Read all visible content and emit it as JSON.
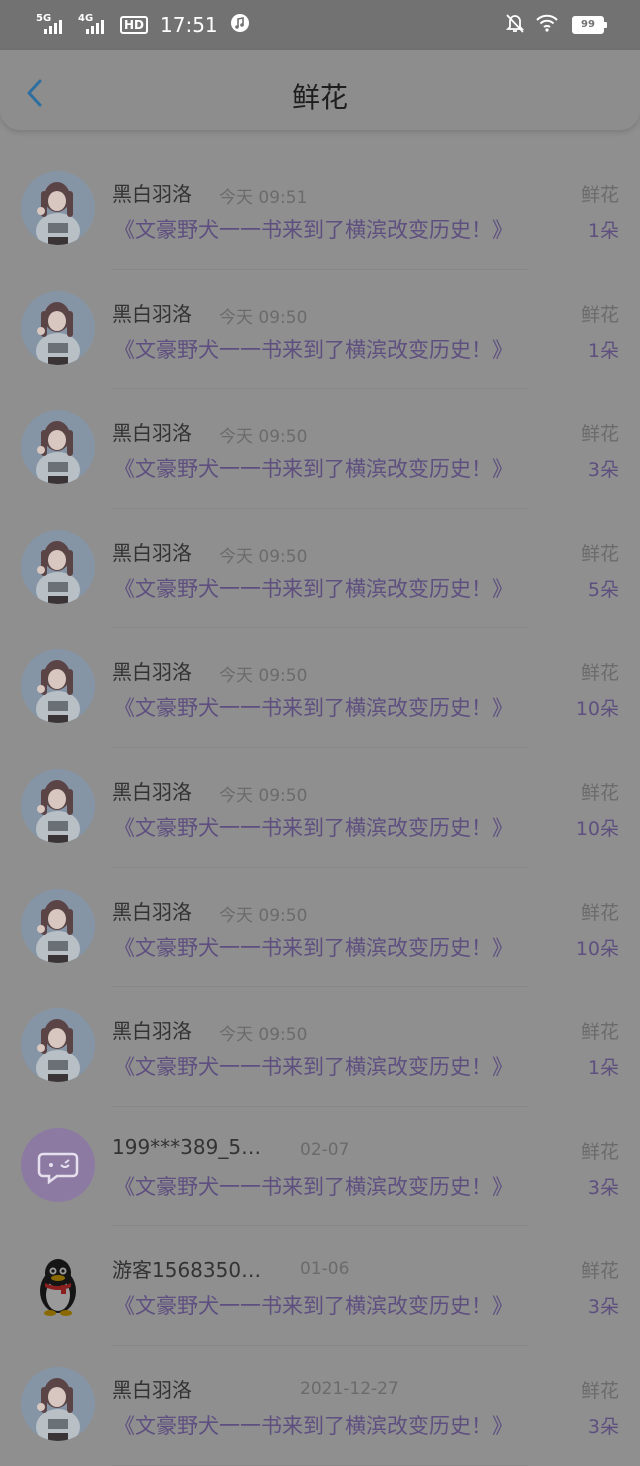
{
  "status_bar": {
    "network_1": "5G",
    "network_2": "4G",
    "hd_badge": "HD",
    "time": "17:51",
    "battery": "99"
  },
  "header": {
    "title": "鲜花",
    "back_icon": "chevron-left-icon"
  },
  "colors": {
    "accent_blue": "#2f6f9f",
    "book_purple": "#5e4f80",
    "avatar_purple": "#8c7aa3"
  },
  "records": [
    {
      "user": "黑白羽洛",
      "time": "今天 09:51",
      "book": "《文豪野犬一一书来到了横滨改变历史！》",
      "gift": "鲜花",
      "count": "1朵",
      "avatar": "anime-girl"
    },
    {
      "user": "黑白羽洛",
      "time": "今天 09:50",
      "book": "《文豪野犬一一书来到了横滨改变历史！》",
      "gift": "鲜花",
      "count": "1朵",
      "avatar": "anime-girl"
    },
    {
      "user": "黑白羽洛",
      "time": "今天 09:50",
      "book": "《文豪野犬一一书来到了横滨改变历史！》",
      "gift": "鲜花",
      "count": "3朵",
      "avatar": "anime-girl"
    },
    {
      "user": "黑白羽洛",
      "time": "今天 09:50",
      "book": "《文豪野犬一一书来到了横滨改变历史！》",
      "gift": "鲜花",
      "count": "5朵",
      "avatar": "anime-girl"
    },
    {
      "user": "黑白羽洛",
      "time": "今天 09:50",
      "book": "《文豪野犬一一书来到了横滨改变历史！》",
      "gift": "鲜花",
      "count": "10朵",
      "avatar": "anime-girl"
    },
    {
      "user": "黑白羽洛",
      "time": "今天 09:50",
      "book": "《文豪野犬一一书来到了横滨改变历史！》",
      "gift": "鲜花",
      "count": "10朵",
      "avatar": "anime-girl"
    },
    {
      "user": "黑白羽洛",
      "time": "今天 09:50",
      "book": "《文豪野犬一一书来到了横滨改变历史！》",
      "gift": "鲜花",
      "count": "10朵",
      "avatar": "anime-girl"
    },
    {
      "user": "黑白羽洛",
      "time": "今天 09:50",
      "book": "《文豪野犬一一书来到了横滨改变历史！》",
      "gift": "鲜花",
      "count": "1朵",
      "avatar": "anime-girl"
    },
    {
      "user": "199***389_5…",
      "time": "02-07",
      "book": "《文豪野犬一一书来到了横滨改变历史！》",
      "gift": "鲜花",
      "count": "3朵",
      "avatar": "chat-bubble"
    },
    {
      "user": "游客1568350…",
      "time": "01-06",
      "book": "《文豪野犬一一书来到了横滨改变历史！》",
      "gift": "鲜花",
      "count": "3朵",
      "avatar": "penguin"
    },
    {
      "user": "黑白羽洛",
      "time": "2021-12-27",
      "book": "《文豪野犬一一书来到了横滨改变历史！》",
      "gift": "鲜花",
      "count": "3朵",
      "avatar": "anime-girl"
    }
  ]
}
